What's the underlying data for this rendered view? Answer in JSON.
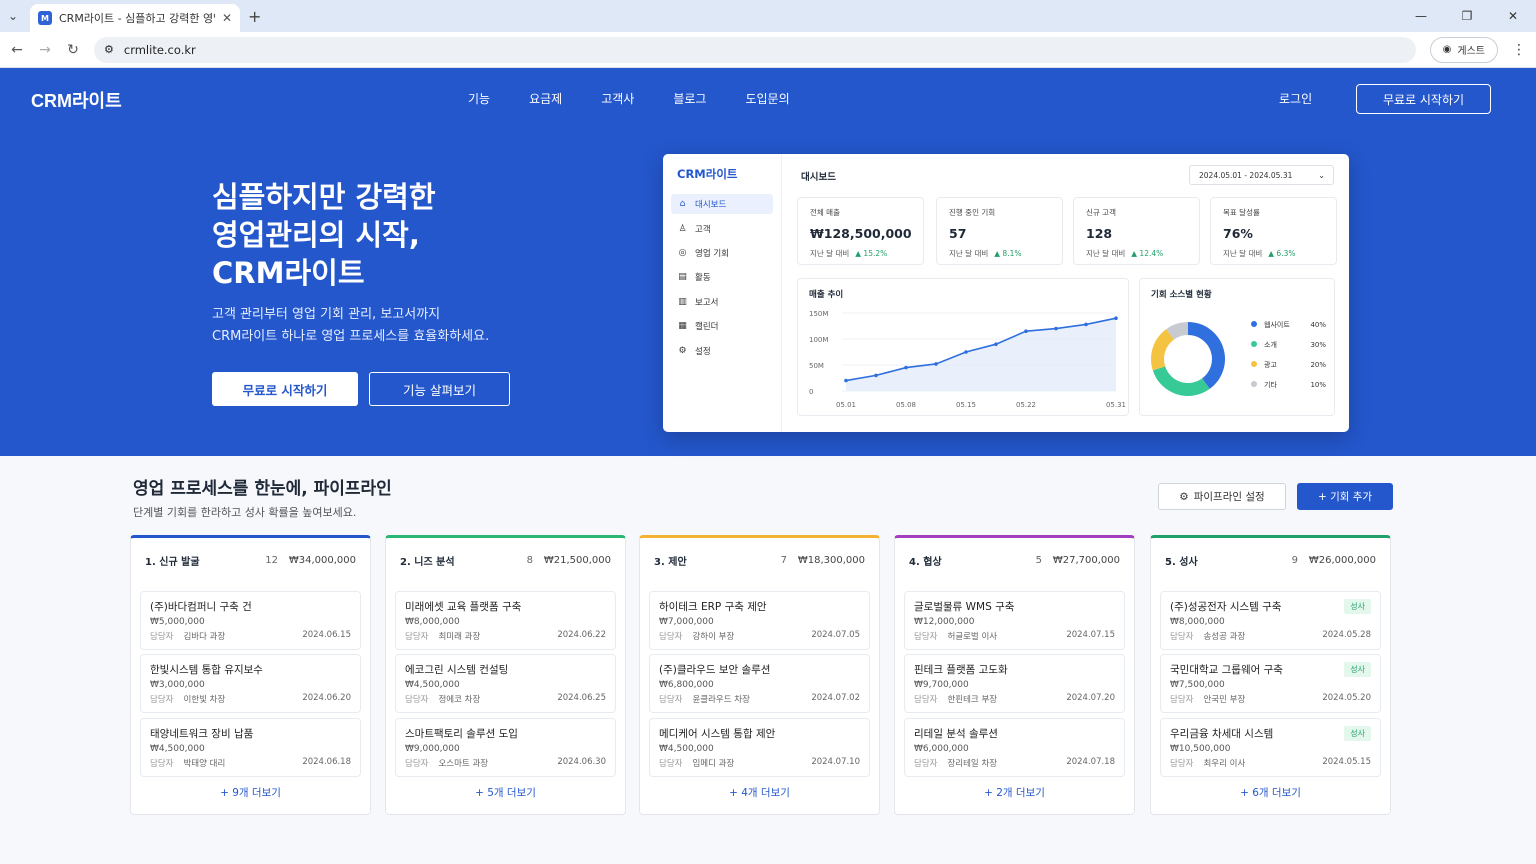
{
  "browser": {
    "tab_title": "CRM라이트 - 심플하고 강력한 영업관리",
    "url": "crmlite.co.kr",
    "guest_label": "게스트"
  },
  "nav": {
    "logo": "CRM라이트",
    "links": [
      "기능",
      "요금제",
      "고객사",
      "블로그",
      "도입문의"
    ],
    "login": "로그인",
    "start": "무료로 시작하기"
  },
  "hero": {
    "title": "심플하지만 강력한\n영업관리의 시작,\nCRM라이트",
    "subtitle": "고객 관리부터 영업 기회 관리, 보고서까지\nCRM라이트 하나로 영업 프로세스를 효율화하세요.",
    "primary_btn": "무료로 시작하기",
    "secondary_btn": "기능 살펴보기"
  },
  "dashboard": {
    "logo": "CRM라이트",
    "menu": [
      {
        "label": "대시보드",
        "icon": "home-icon"
      },
      {
        "label": "고객",
        "icon": "user-icon"
      },
      {
        "label": "영업 기회",
        "icon": "target-icon"
      },
      {
        "label": "활동",
        "icon": "list-icon"
      },
      {
        "label": "보고서",
        "icon": "bar-chart-icon"
      },
      {
        "label": "캘린더",
        "icon": "calendar-icon"
      },
      {
        "label": "설정",
        "icon": "gear-icon"
      }
    ],
    "title": "대시보드",
    "date_range": "2024.05.01 - 2024.05.31",
    "kpis": [
      {
        "label": "전체 매출",
        "value": "₩128,500,000",
        "compare": "지난 달 대비",
        "delta": "▲ 15.2%"
      },
      {
        "label": "진행 중인 기회",
        "value": "57",
        "compare": "지난 달 대비",
        "delta": "▲ 8.1%"
      },
      {
        "label": "신규 고객",
        "value": "128",
        "compare": "지난 달 대비",
        "delta": "▲ 12.4%"
      },
      {
        "label": "목표 달성률",
        "value": "76%",
        "compare": "지난 달 대비",
        "delta": "▲ 6.3%"
      }
    ]
  },
  "chart_data": [
    {
      "type": "area",
      "title": "매출 추이",
      "x": [
        "05.01",
        "05.04",
        "05.08",
        "05.11",
        "05.15",
        "05.19",
        "05.22",
        "05.25",
        "05.28",
        "05.31"
      ],
      "tick_labels_x": [
        "05.01",
        "05.08",
        "05.15",
        "05.22",
        "05.31"
      ],
      "tick_labels_y": [
        "0",
        "50M",
        "100M",
        "150M"
      ],
      "ylim": [
        0,
        150
      ],
      "values": [
        20,
        30,
        45,
        52,
        75,
        90,
        115,
        120,
        128,
        140
      ],
      "grid": true,
      "color": "#2f6fde"
    },
    {
      "type": "pie",
      "title": "기회 소스별 현황",
      "labels": [
        "웹사이트",
        "소개",
        "광고",
        "기타"
      ],
      "values": [
        40,
        30,
        20,
        10
      ],
      "display": [
        "40%",
        "30%",
        "20%",
        "10%"
      ],
      "colors": [
        "#2f6fde",
        "#37c996",
        "#f5c342",
        "#c7cbd1"
      ],
      "legend": "right"
    }
  ],
  "pipeline": {
    "title": "영업 프로세스를 한눈에, 파이프라인",
    "subtitle": "단계별 기회를 한라하고 성사 확률을 높여보세요.",
    "settings_btn": "파이프라인 설정",
    "add_btn": "+ 기회 추가",
    "owner_label": "담당자",
    "columns": [
      {
        "name": "1. 신규 발굴",
        "count": "12",
        "amount": "₩34,000,000",
        "color": "#2457cc",
        "cards": [
          {
            "title": "(주)바다컴퍼니 구축 건",
            "value": "₩5,000,000",
            "owner": "김바다 과장",
            "date": "2024.06.15"
          },
          {
            "title": "한빛시스템 통합 유지보수",
            "value": "₩3,000,000",
            "owner": "이한빛 차장",
            "date": "2024.06.20"
          },
          {
            "title": "태양네트워크 장비 납품",
            "value": "₩4,500,000",
            "owner": "박태양 대리",
            "date": "2024.06.18"
          }
        ],
        "more": "+ 9개 더보기"
      },
      {
        "name": "2. 니즈 분석",
        "count": "8",
        "amount": "₩21,500,000",
        "color": "#2bb673",
        "cards": [
          {
            "title": "미래에셋 교육 플랫폼 구축",
            "value": "₩8,000,000",
            "owner": "최미래 과장",
            "date": "2024.06.22"
          },
          {
            "title": "에코그린 시스템 컨설팅",
            "value": "₩4,500,000",
            "owner": "정에코 차장",
            "date": "2024.06.25"
          },
          {
            "title": "스마트팩토리 솔루션 도입",
            "value": "₩9,000,000",
            "owner": "오스마트 과장",
            "date": "2024.06.30"
          }
        ],
        "more": "+ 5개 더보기"
      },
      {
        "name": "3. 제안",
        "count": "7",
        "amount": "₩18,300,000",
        "color": "#f2b233",
        "cards": [
          {
            "title": "하이테크 ERP 구축 제안",
            "value": "₩7,000,000",
            "owner": "강하이 부장",
            "date": "2024.07.05"
          },
          {
            "title": "(주)클라우드 보안 솔루션",
            "value": "₩6,800,000",
            "owner": "윤클라우드 차장",
            "date": "2024.07.02"
          },
          {
            "title": "메디케어 시스템 통합 제안",
            "value": "₩4,500,000",
            "owner": "임메디 과장",
            "date": "2024.07.10"
          }
        ],
        "more": "+ 4개 더보기"
      },
      {
        "name": "4. 협상",
        "count": "5",
        "amount": "₩27,700,000",
        "color": "#a23fc0",
        "cards": [
          {
            "title": "글로벌물류 WMS 구축",
            "value": "₩12,000,000",
            "owner": "허글로벌 이사",
            "date": "2024.07.15"
          },
          {
            "title": "핀테크 플랫폼 고도화",
            "value": "₩9,700,000",
            "owner": "한핀테크 부장",
            "date": "2024.07.20"
          },
          {
            "title": "리테일 분석 솔루션",
            "value": "₩6,000,000",
            "owner": "장리테일 차장",
            "date": "2024.07.18"
          }
        ],
        "more": "+ 2개 더보기"
      },
      {
        "name": "5. 성사",
        "count": "9",
        "amount": "₩26,000,000",
        "color": "#22a06b",
        "badge": "성사",
        "cards": [
          {
            "title": "(주)성공전자 시스템 구축",
            "value": "₩8,000,000",
            "owner": "송성공 과장",
            "date": "2024.05.28"
          },
          {
            "title": "국민대학교 그룹웨어 구축",
            "value": "₩7,500,000",
            "owner": "안국민 부장",
            "date": "2024.05.20"
          },
          {
            "title": "우리금융 차세대 시스템",
            "value": "₩10,500,000",
            "owner": "최우리 이사",
            "date": "2024.05.15"
          }
        ],
        "more": "+ 6개 더보기"
      }
    ]
  }
}
